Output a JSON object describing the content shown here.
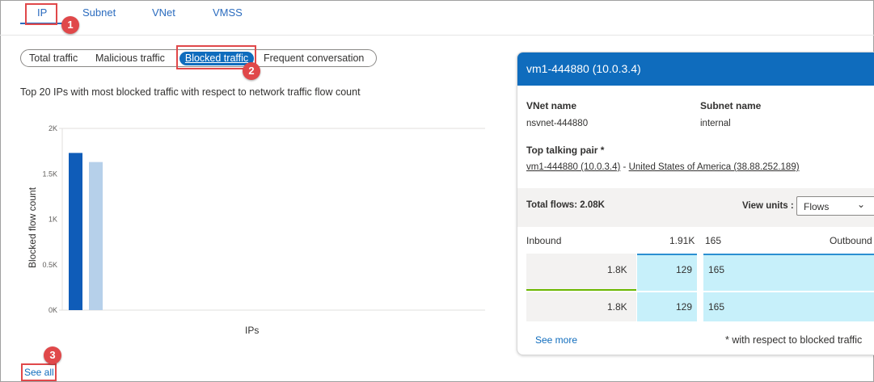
{
  "tabs": [
    "IP",
    "Subnet",
    "VNet",
    "VMSS"
  ],
  "filters": [
    "Total traffic",
    "Malicious traffic",
    "Blocked traffic",
    "Frequent conversation"
  ],
  "callouts": [
    "1",
    "2",
    "3"
  ],
  "subtitle": "Top 20 IPs with most blocked traffic with respect to network traffic flow count",
  "chart_data": {
    "type": "bar",
    "categories": [
      "",
      ""
    ],
    "values": [
      1730,
      1630
    ],
    "colors": [
      "#0f5cb8",
      "#b6d0ea"
    ],
    "ylabel": "Blocked flow count",
    "xlabel": "IPs",
    "yticks": [
      "0K",
      "0.5K",
      "1K",
      "1.5K",
      "2K"
    ],
    "ylim": [
      0,
      2000
    ],
    "grid": true
  },
  "see_all": "See all",
  "card": {
    "title": "vm1-444880 (10.0.3.4)",
    "vnet_label": "VNet name",
    "vnet_value": "nsvnet-444880",
    "subnet_label": "Subnet name",
    "subnet_value": "internal",
    "pair_label": "Top talking pair *",
    "pair_left": "vm1-444880 (10.0.3.4)",
    "pair_sep": " - ",
    "pair_right": "United States of America (38.88.252.189)",
    "total_flows": "Total flows: 2.08K",
    "view_units_label": "View units :",
    "view_units_value": "Flows",
    "flow_header": {
      "inbound": "Inbound",
      "inbound_total": "1.91K",
      "outbound_total": "165",
      "outbound": "Outbound"
    },
    "flow_rows": [
      {
        "a": "1.8K",
        "b": "129",
        "c": "165"
      },
      {
        "a": "1.8K",
        "b": "129",
        "c": "165"
      }
    ],
    "see_more": "See more",
    "footnote": "* with respect to blocked traffic"
  },
  "colors": {
    "accent": "#0f6cbd",
    "callout": "#e0484a",
    "green": "#6bb700",
    "cyan": "#c7f0fa",
    "border_blue": "#2b8fd1"
  }
}
